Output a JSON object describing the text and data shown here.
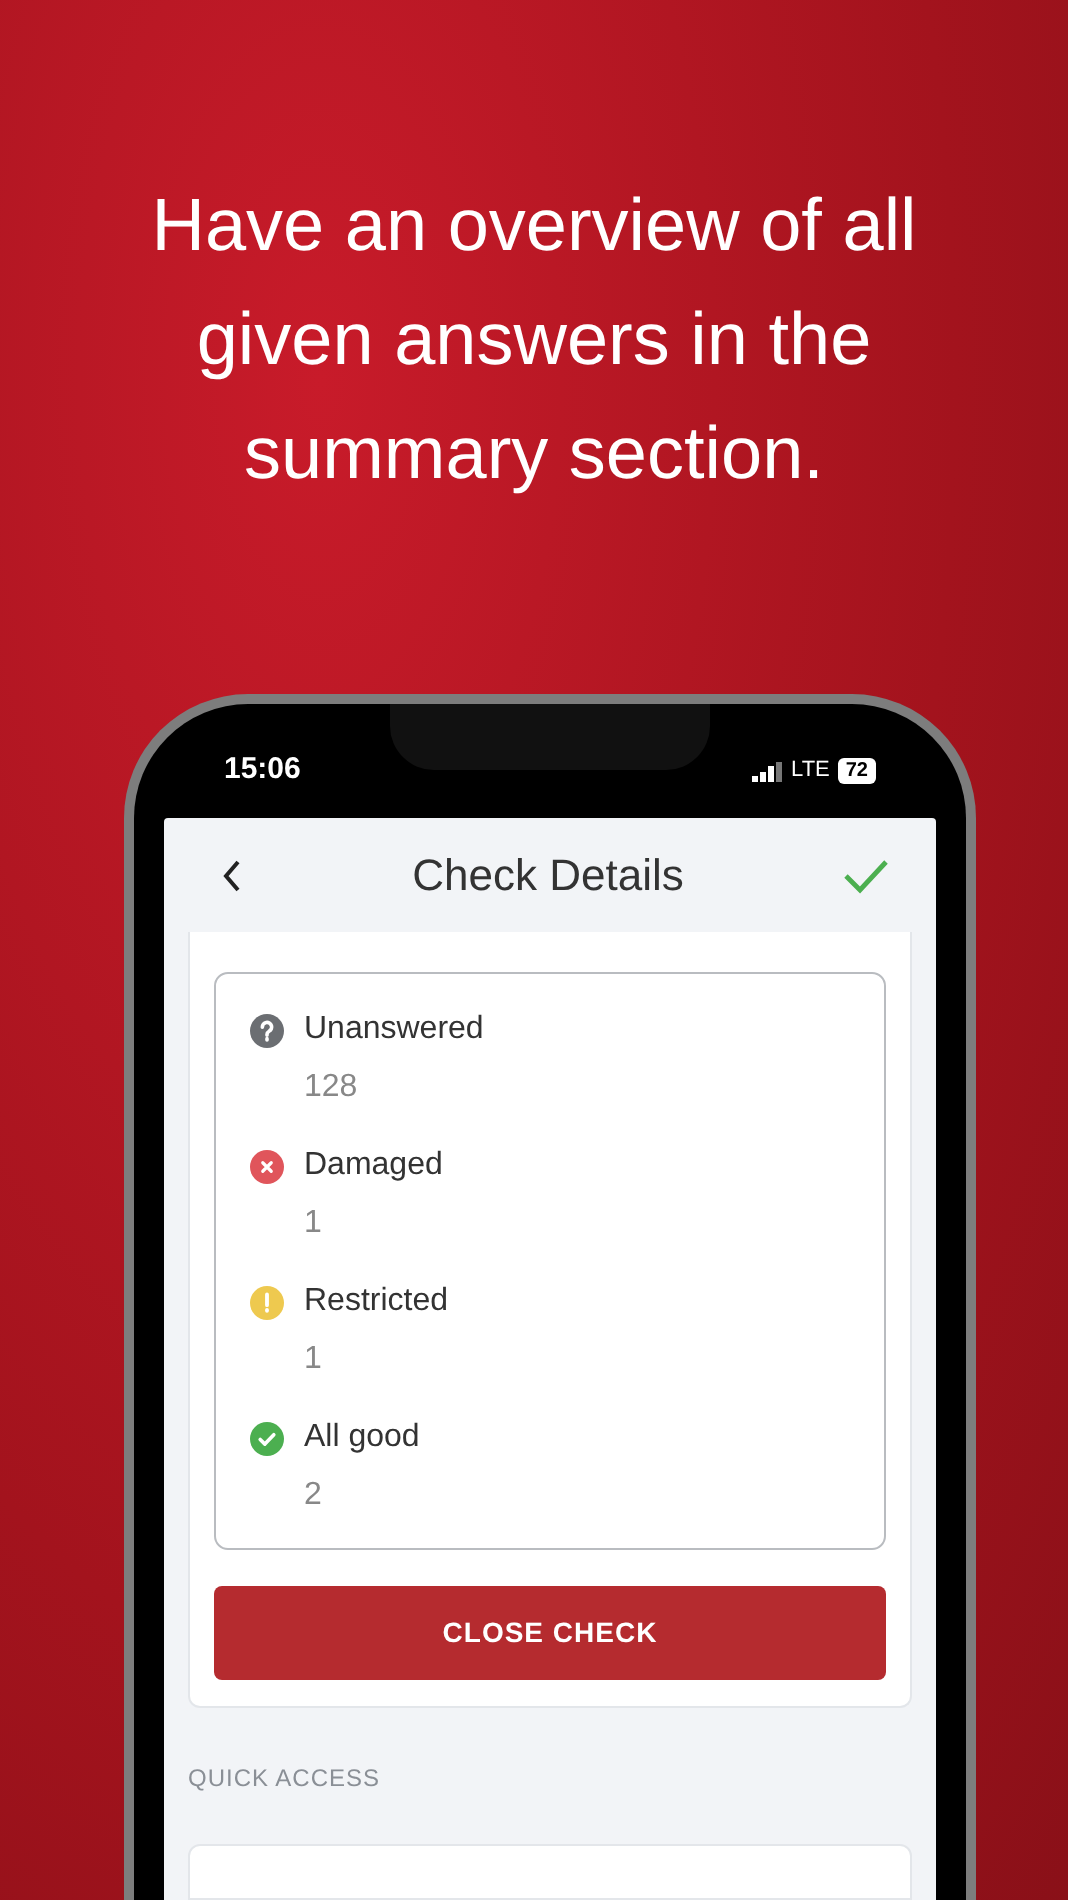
{
  "headline": "Have an overview of all given answers in the summary section.",
  "status_bar": {
    "time": "15:06",
    "network": "LTE",
    "battery": "72"
  },
  "nav": {
    "title": "Check Details"
  },
  "summary": [
    {
      "kind": "unanswered",
      "label": "Unanswered",
      "count": "128"
    },
    {
      "kind": "damaged",
      "label": "Damaged",
      "count": "1"
    },
    {
      "kind": "restricted",
      "label": "Restricted",
      "count": "1"
    },
    {
      "kind": "good",
      "label": "All good",
      "count": "2"
    }
  ],
  "close_button": "CLOSE CHECK",
  "section_label": "QUICK ACCESS"
}
